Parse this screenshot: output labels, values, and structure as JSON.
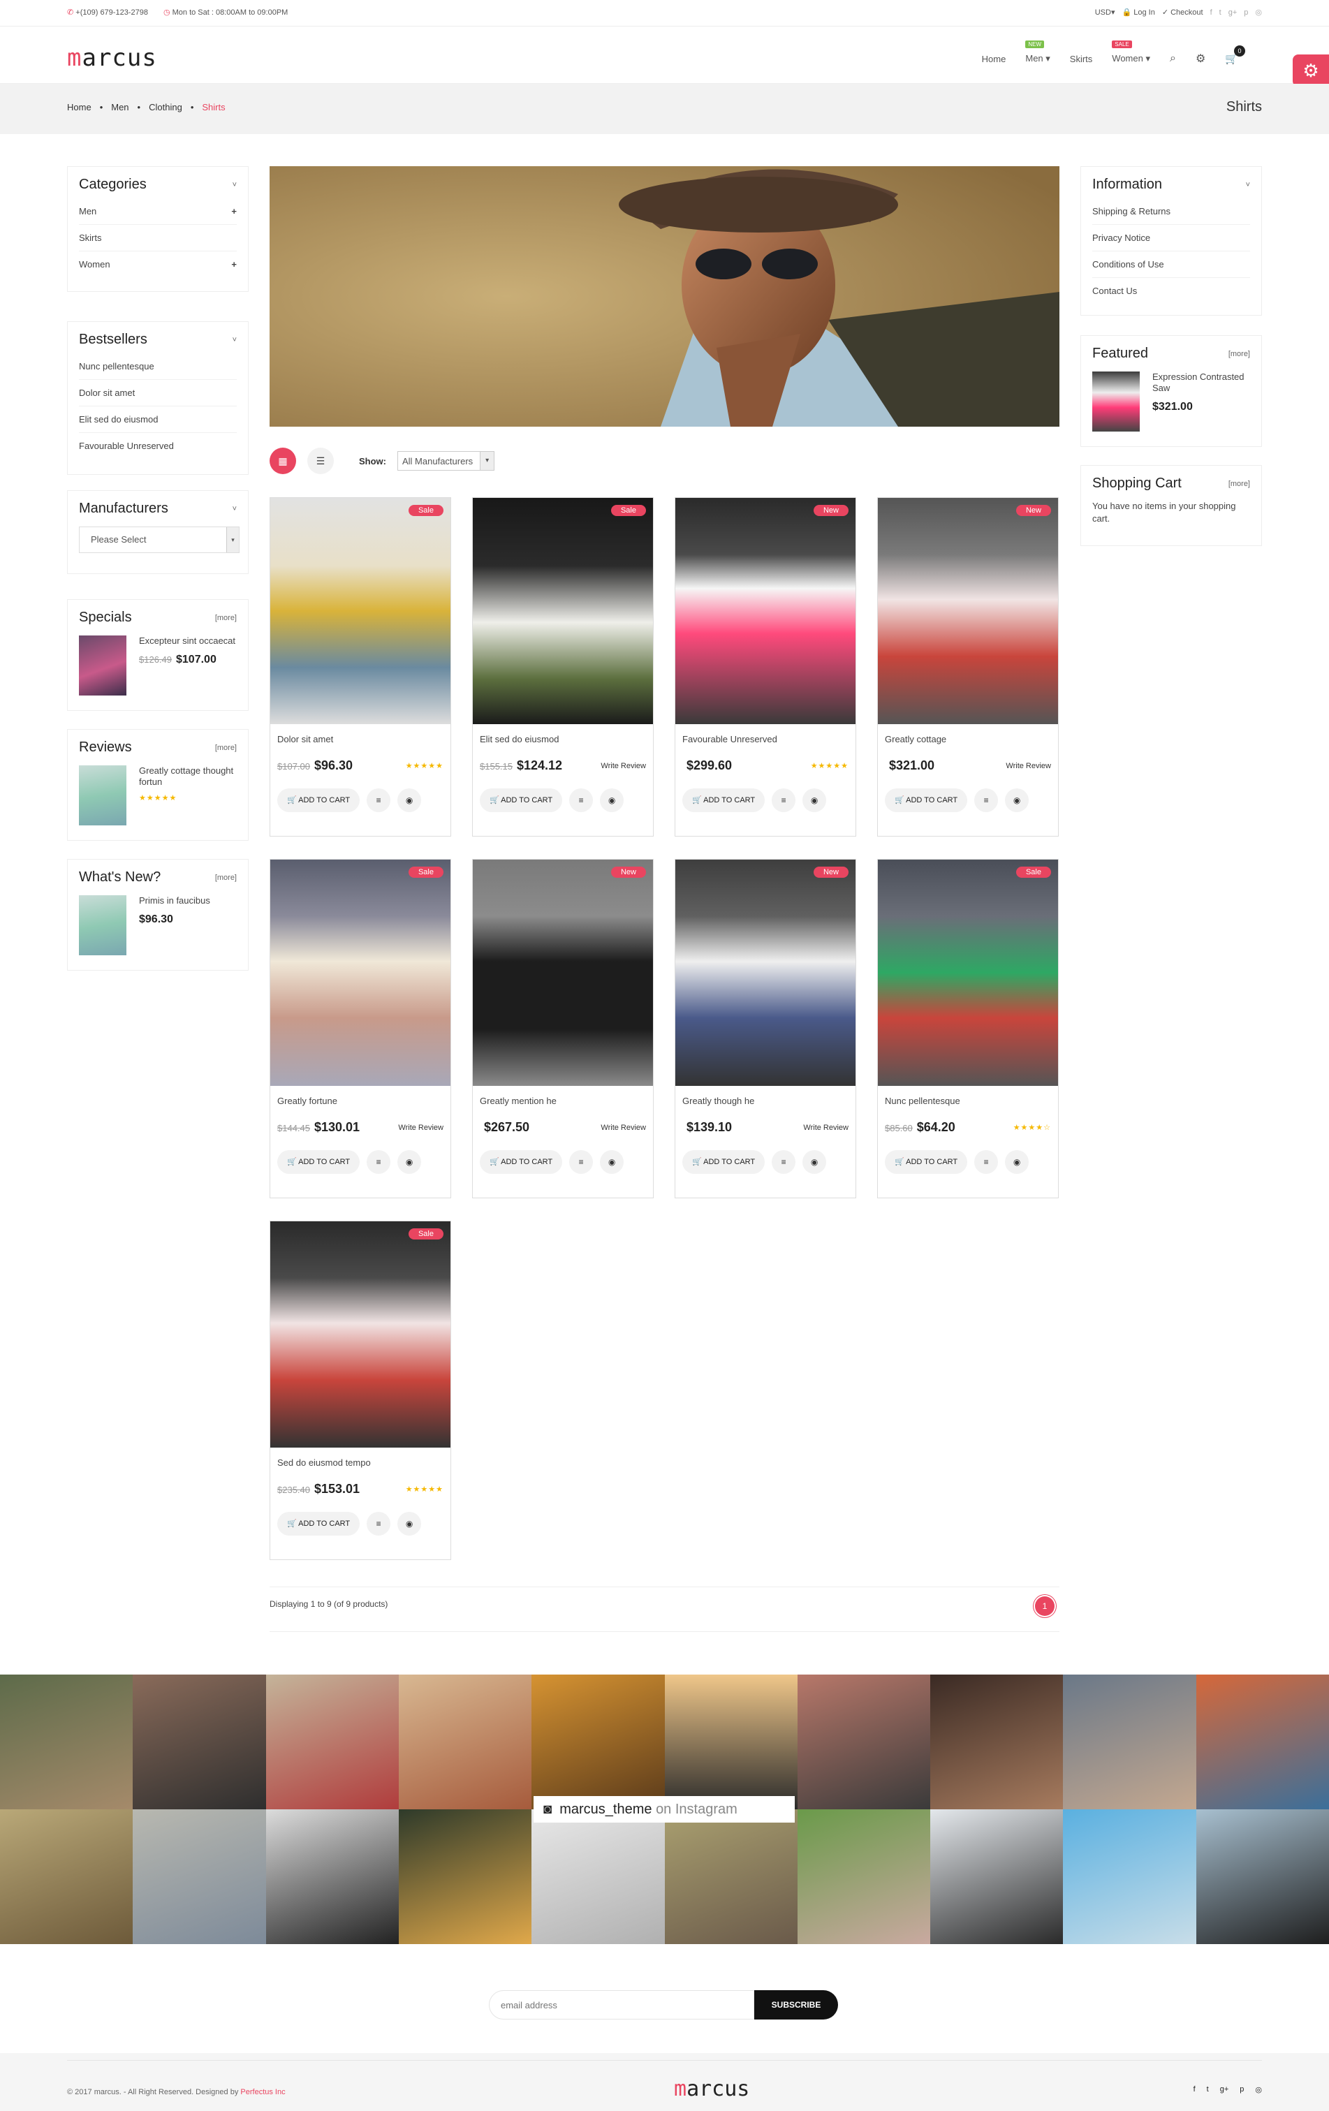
{
  "topbar": {
    "phone": "+(109) 679-123-2798",
    "hours": "Mon to Sat : 08:00AM to 09:00PM",
    "currency": "USD",
    "login": "Log In",
    "checkout": "Checkout",
    "social": [
      "f",
      "t",
      "g+",
      "p",
      "◎"
    ]
  },
  "header": {
    "logo_accent": "m",
    "logo_rest": "arcus",
    "nav": [
      {
        "label": "Home"
      },
      {
        "label": "Men",
        "badge": "NEW",
        "badge_color": "#7cc14a"
      },
      {
        "label": "Skirts"
      },
      {
        "label": "Women",
        "badge": "SALE",
        "badge_color": "#e94560"
      }
    ],
    "cart_count": "0"
  },
  "breadcrumb": {
    "items": [
      "Home",
      "Men",
      "Clothing"
    ],
    "current": "Shirts",
    "title": "Shirts"
  },
  "sidebar_left": {
    "categories": {
      "title": "Categories",
      "items": [
        {
          "label": "Men",
          "plus": "+"
        },
        {
          "label": "Skirts",
          "plus": ""
        },
        {
          "label": "Women",
          "plus": "+"
        }
      ]
    },
    "bestsellers": {
      "title": "Bestsellers",
      "items": [
        "Nunc pellentesque",
        "Dolor sit amet",
        "Elit sed do eiusmod",
        "Favourable Unreserved"
      ]
    },
    "manufacturers": {
      "title": "Manufacturers",
      "select": "Please Select"
    },
    "specials": {
      "title": "Specials",
      "more": "[more]",
      "name": "Excepteur sint occaecat",
      "old": "$126.49",
      "price": "$107.00"
    },
    "reviews": {
      "title": "Reviews",
      "more": "[more]",
      "name": "Greatly cottage thought fortun",
      "stars": "★★★★★"
    },
    "whatsnew": {
      "title": "What's New?",
      "more": "[more]",
      "name": "Primis in faucibus",
      "price": "$96.30"
    }
  },
  "sidebar_right": {
    "information": {
      "title": "Information",
      "items": [
        "Shipping & Returns",
        "Privacy Notice",
        "Conditions of Use",
        "Contact Us"
      ]
    },
    "featured": {
      "title": "Featured",
      "more": "[more]",
      "name": "Expression Contrasted Saw",
      "price": "$321.00"
    },
    "cart": {
      "title": "Shopping Cart",
      "more": "[more]",
      "text": "You have no items in your shopping cart."
    }
  },
  "listing": {
    "show_label": "Show:",
    "manufacturer": "All Manufacturers",
    "add_to_cart": "ADD TO CART",
    "write_review": "Write Review",
    "products": [
      {
        "name": "Dolor sit amet",
        "tag": "Sale",
        "old": "$107.00",
        "price": "$96.30",
        "stars": "★★★★★",
        "review": ""
      },
      {
        "name": "Elit sed do eiusmod",
        "tag": "Sale",
        "old": "$155.15",
        "price": "$124.12",
        "stars": "",
        "review": "Write Review"
      },
      {
        "name": "Favourable Unreserved",
        "tag": "New",
        "old": "",
        "price": "$299.60",
        "stars": "★★★★★",
        "review": ""
      },
      {
        "name": "Greatly cottage",
        "tag": "New",
        "old": "",
        "price": "$321.00",
        "stars": "",
        "review": "Write Review"
      },
      {
        "name": "Greatly fortune",
        "tag": "Sale",
        "old": "$144.45",
        "price": "$130.01",
        "stars": "",
        "review": "Write Review"
      },
      {
        "name": "Greatly mention he",
        "tag": "New",
        "old": "",
        "price": "$267.50",
        "stars": "",
        "review": "Write Review"
      },
      {
        "name": "Greatly though he",
        "tag": "New",
        "old": "",
        "price": "$139.10",
        "stars": "",
        "review": "Write Review"
      },
      {
        "name": "Nunc pellentesque",
        "tag": "Sale",
        "old": "$85.60",
        "price": "$64.20",
        "stars": "★★★★☆",
        "review": ""
      },
      {
        "name": "Sed do eiusmod tempo",
        "tag": "Sale",
        "old": "$235.40",
        "price": "$153.01",
        "stars": "★★★★★",
        "review": ""
      }
    ],
    "displaying": "Displaying 1 to 9 (of 9 products)",
    "page": "1"
  },
  "instagram": {
    "handle": "marcus_theme",
    "suffix": "on Instagram"
  },
  "newsletter": {
    "placeholder": "email address",
    "button": "SUBSCRIBE"
  },
  "footer": {
    "copy": "© 2017 marcus. - All Right Reserved. Designed by",
    "designer": "Perfectus Inc",
    "social": [
      "f",
      "t",
      "g+",
      "p",
      "◎"
    ]
  },
  "colors": {
    "accent": "#e94560"
  }
}
